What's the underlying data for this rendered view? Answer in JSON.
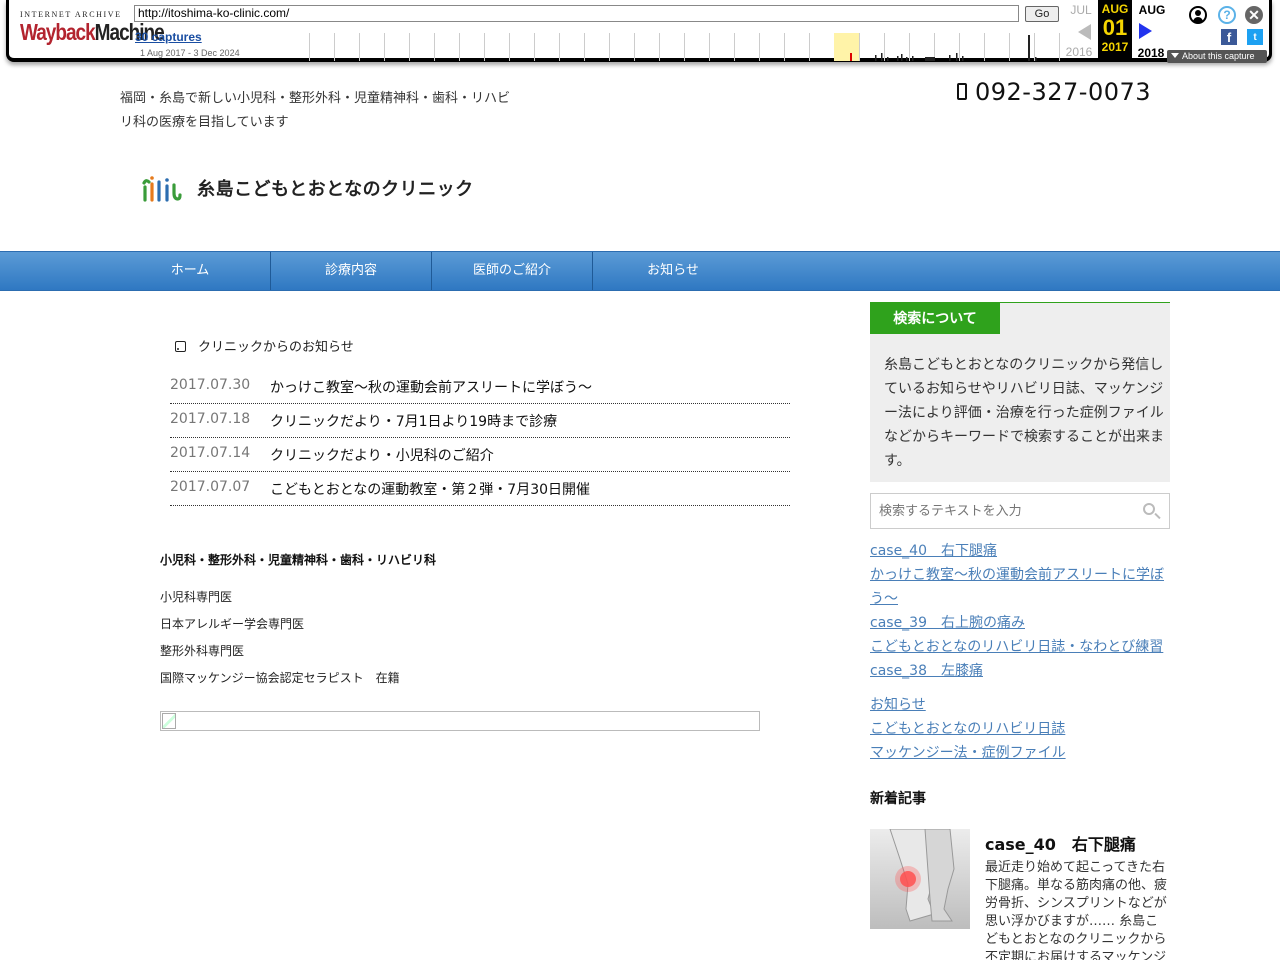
{
  "wayback": {
    "logo_top": "INTERNET ARCHIVE",
    "logo_word1": "Wayback",
    "logo_word2": "Machine",
    "url": "http://itoshima-ko-clinic.com/",
    "go_label": "Go",
    "captures": "30 captures",
    "range": "1 Aug 2017 - 3 Dec 2024",
    "prev_month": "JUL",
    "prev_year": "2016",
    "cur_month": "AUG",
    "cur_day": "01",
    "cur_year": "2017",
    "next_month": "AUG",
    "next_year": "2018",
    "about": "About this capture",
    "help_glyph": "?",
    "close_glyph": "✕",
    "fb_glyph": "f",
    "tw_glyph": "t",
    "icons": [
      "user-icon",
      "help-icon",
      "close-icon",
      "facebook-icon",
      "twitter-icon"
    ]
  },
  "header": {
    "tagline": "福岡・糸島で新しい小児科・整形外科・児童精神科・歯科・リハビリ科の医療を目指しています",
    "phone": "092-327-0073",
    "logo_text": "糸島こどもとおとなのクリニック"
  },
  "nav": {
    "items": [
      "ホーム",
      "診療内容",
      "医師のご紹介",
      "お知らせ"
    ]
  },
  "news": {
    "heading": "クリニックからのお知らせ",
    "items": [
      {
        "date": "2017.07.30",
        "title": "かっけこ教室〜秋の運動会前アスリートに学ぼう〜"
      },
      {
        "date": "2017.07.18",
        "title": "クリニックだより・7月1日より19時まで診療"
      },
      {
        "date": "2017.07.14",
        "title": "クリニックだより・小児科のご紹介"
      },
      {
        "date": "2017.07.07",
        "title": "こどもとおとなの運動教室・第２弾・7月30日開催"
      }
    ]
  },
  "specialties": {
    "title": "小児科・整形外科・児童精神科・歯科・リハビリ科",
    "lines": [
      "小児科専門医",
      "日本アレルギー学会専門医",
      "整形外科専門医",
      "国際マッケンジー協会認定セラピスト　在籍"
    ]
  },
  "sidebar": {
    "search_about_title": "検索について",
    "search_about_body": "糸島こどもとおとなのクリニックから発信しているお知らせやリハビリ日誌、マッケンジー法により評価・治療を行った症例ファイルなどからキーワードで検索することが出来ます。",
    "search_placeholder": "検索するテキストを入力",
    "recent_links": [
      "case_40　右下腿痛",
      "かっけこ教室〜秋の運動会前アスリートに学ぼう〜",
      "case_39　右上腕の痛み",
      "こどもとおとなのリハビリ日誌・なわとび練習",
      "case_38　左膝痛"
    ],
    "category_links": [
      "お知らせ",
      "こどもとおとなのリハビリ日誌",
      "マッケンジー法・症例ファイル"
    ],
    "new_heading": "新着記事",
    "new_title": "case_40　右下腿痛",
    "new_excerpt": "最近走り始めて起こってきた右下腿痛。単なる筋肉痛の他、疲労骨折、シンスプリントなどが思い浮かびますが…… 糸島こどもとおとなのクリニックから不定期にお届けするマッケンジー"
  },
  "colors": {
    "nav_blue": "#2f78c2",
    "accent_green": "#2fa21c",
    "link_blue": "#4a7fb8",
    "wayback_red": "#b3242f",
    "wayback_yellow": "#f5d500"
  }
}
